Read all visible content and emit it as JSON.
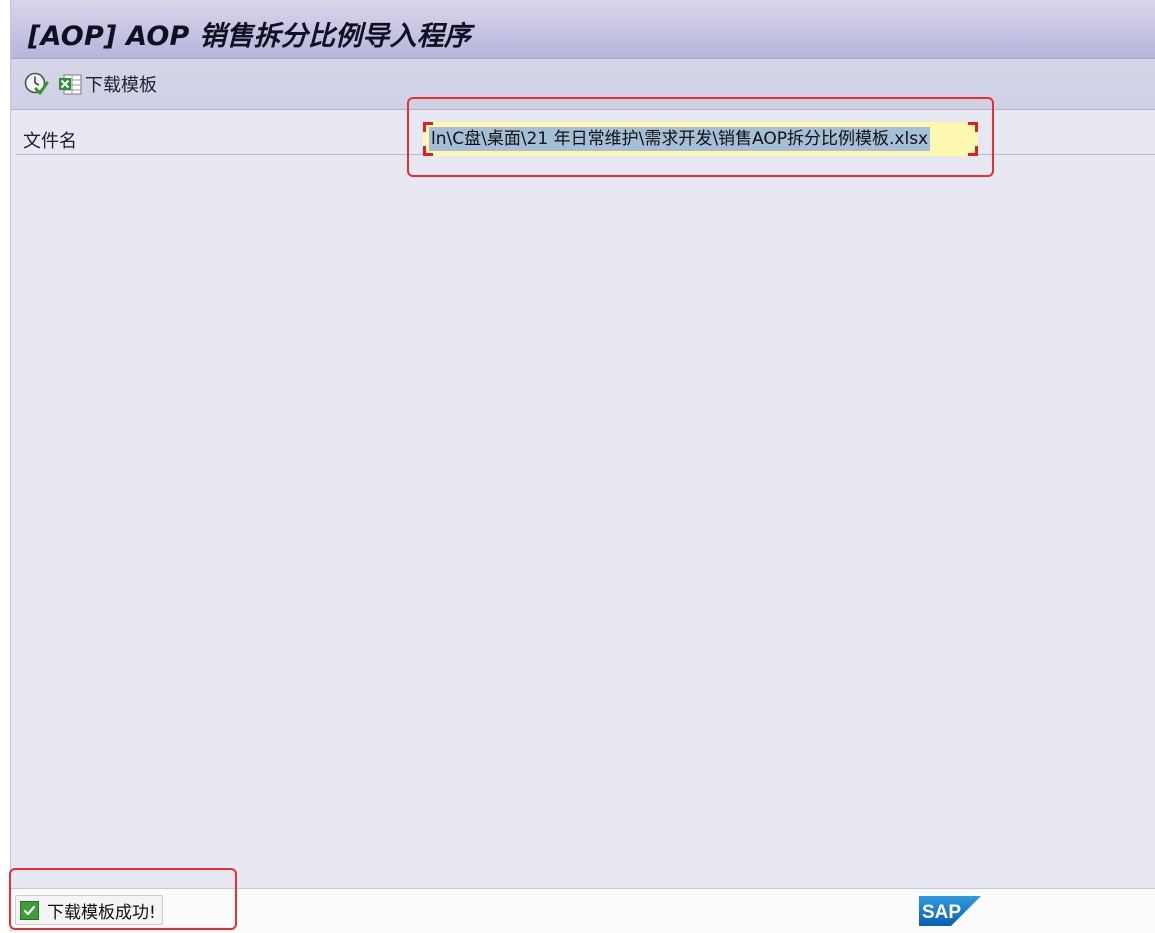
{
  "window": {
    "title": "[AOP] AOP 销售拆分比例导入程序"
  },
  "toolbar": {
    "execute_icon": "execute-clock-check-icon",
    "download_icon": "excel-download-icon",
    "download_label": "下载模板"
  },
  "form": {
    "file_label": "文件名",
    "file_value": "ln\\C盘\\桌面\\21 年日常维护\\需求开发\\销售AOP拆分比例模板.xlsx"
  },
  "status": {
    "icon": "success-check-icon",
    "message": "下载模板成功!"
  },
  "brand": {
    "logo_text": "SAP"
  },
  "colors": {
    "highlight": "#e8312f",
    "input_bg": "#fdf8b0",
    "selection": "#a5bfd8"
  }
}
